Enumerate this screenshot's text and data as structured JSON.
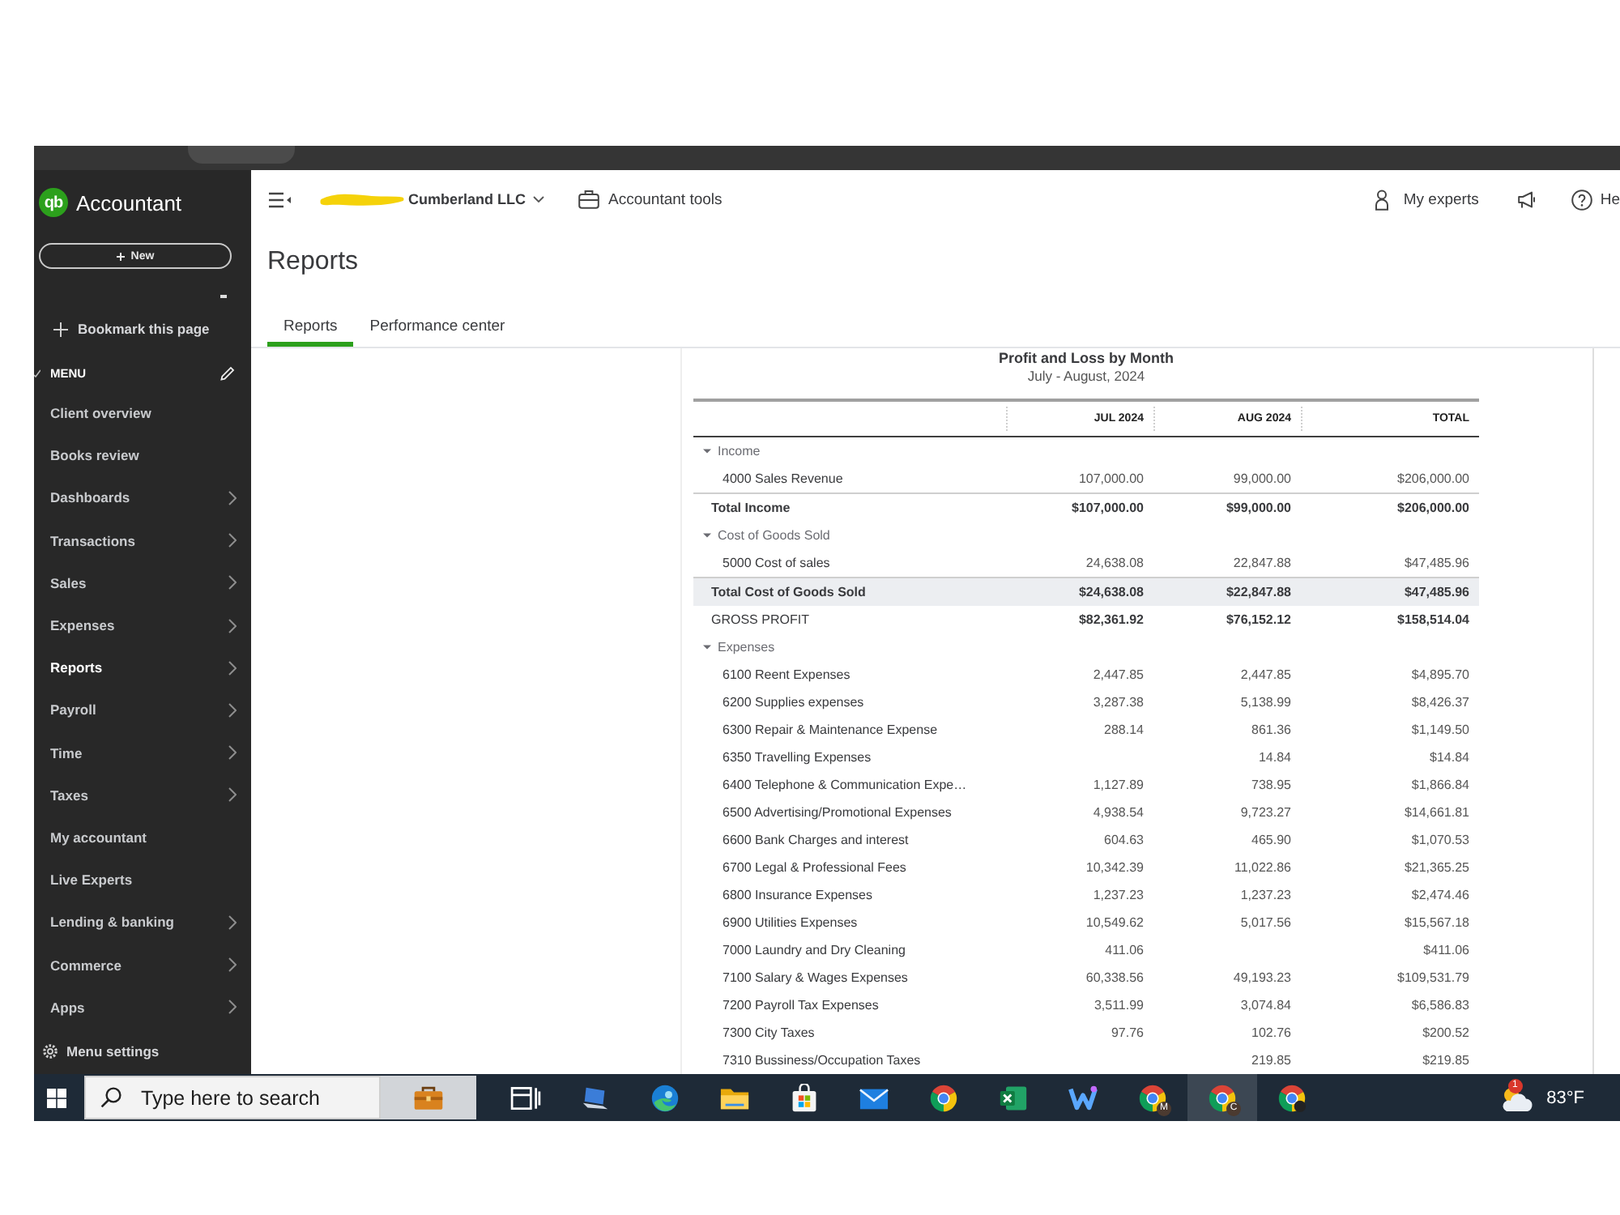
{
  "sidebar": {
    "logo_mark": "qb",
    "product": "Accountant",
    "new_button": "New",
    "bookmark": "Bookmark this page",
    "menu_heading": "MENU",
    "items": [
      {
        "label": "Client overview",
        "submenu": false,
        "selected": false
      },
      {
        "label": "Books review",
        "submenu": false,
        "selected": false
      },
      {
        "label": "Dashboards",
        "submenu": true,
        "selected": false
      },
      {
        "label": "Transactions",
        "submenu": true,
        "selected": false
      },
      {
        "label": "Sales",
        "submenu": true,
        "selected": false
      },
      {
        "label": "Expenses",
        "submenu": true,
        "selected": false
      },
      {
        "label": "Reports",
        "submenu": true,
        "selected": true
      },
      {
        "label": "Payroll",
        "submenu": true,
        "selected": false
      },
      {
        "label": "Time",
        "submenu": true,
        "selected": false
      },
      {
        "label": "Taxes",
        "submenu": true,
        "selected": false
      },
      {
        "label": "My accountant",
        "submenu": false,
        "selected": false
      },
      {
        "label": "Live Experts",
        "submenu": false,
        "selected": false
      },
      {
        "label": "Lending & banking",
        "submenu": true,
        "selected": false
      },
      {
        "label": "Commerce",
        "submenu": true,
        "selected": false
      },
      {
        "label": "Apps",
        "submenu": true,
        "selected": false
      }
    ],
    "settings": "Menu settings"
  },
  "header": {
    "company": "Cumberland LLC",
    "accountant_tools": "Accountant tools",
    "my_experts": "My experts",
    "help": "He"
  },
  "page": {
    "title": "Reports",
    "tabs": [
      {
        "label": "Reports",
        "selected": true
      },
      {
        "label": "Performance center",
        "selected": false
      }
    ]
  },
  "report": {
    "title": "Profit and Loss by Month",
    "subtitle": "July - August, 2024",
    "columns": [
      "JUL 2024",
      "AUG 2024",
      "TOTAL"
    ],
    "rows": [
      {
        "kind": "section",
        "label": "Income",
        "expanded": true,
        "highlighted": false,
        "children": [
          {
            "label": "4000 Sales Revenue",
            "jul_2024": "107,000.00",
            "aug_2024": "99,000.00",
            "total": "$206,000.00"
          }
        ]
      },
      {
        "kind": "total",
        "label": "Total Income",
        "highlighted": false,
        "jul_2024": "$107,000.00",
        "aug_2024": "$99,000.00",
        "total": "$206,000.00"
      },
      {
        "kind": "section",
        "label": "Cost of Goods Sold",
        "expanded": true,
        "highlighted": false,
        "children": [
          {
            "label": "5000 Cost of sales",
            "jul_2024": "24,638.08",
            "aug_2024": "22,847.88",
            "total": "$47,485.96"
          }
        ]
      },
      {
        "kind": "total",
        "label": "Total Cost of Goods Sold",
        "highlighted": true,
        "jul_2024": "$24,638.08",
        "aug_2024": "$22,847.88",
        "total": "$47,485.96"
      },
      {
        "kind": "summary",
        "label": "GROSS PROFIT",
        "highlighted": false,
        "jul_2024": "$82,361.92",
        "aug_2024": "$76,152.12",
        "total": "$158,514.04"
      },
      {
        "kind": "section",
        "label": "Expenses",
        "expanded": true,
        "highlighted": false,
        "children": [
          {
            "label": "6100 Reent Expenses",
            "jul_2024": "2,447.85",
            "aug_2024": "2,447.85",
            "total": "$4,895.70"
          },
          {
            "label": "6200 Supplies expenses",
            "jul_2024": "3,287.38",
            "aug_2024": "5,138.99",
            "total": "$8,426.37"
          },
          {
            "label": "6300 Repair & Maintenance Expense",
            "jul_2024": "288.14",
            "aug_2024": "861.36",
            "total": "$1,149.50"
          },
          {
            "label": "6350 Travelling Expenses",
            "aug_2024": "14.84",
            "total": "$14.84"
          },
          {
            "label": "6400 Telephone & Communication Expe…",
            "jul_2024": "1,127.89",
            "aug_2024": "738.95",
            "total": "$1,866.84"
          },
          {
            "label": "6500 Advertising/Promotional Expenses",
            "jul_2024": "4,938.54",
            "aug_2024": "9,723.27",
            "total": "$14,661.81"
          },
          {
            "label": "6600 Bank Charges and interest",
            "jul_2024": "604.63",
            "aug_2024": "465.90",
            "total": "$1,070.53"
          },
          {
            "label": "6700 Legal & Professional Fees",
            "jul_2024": "10,342.39",
            "aug_2024": "11,022.86",
            "total": "$21,365.25"
          },
          {
            "label": "6800 Insurance Expenses",
            "jul_2024": "1,237.23",
            "aug_2024": "1,237.23",
            "total": "$2,474.46"
          },
          {
            "label": "6900 Utilities Expenses",
            "jul_2024": "10,549.62",
            "aug_2024": "5,017.56",
            "total": "$15,567.18"
          },
          {
            "label": "7000 Laundry and Dry Cleaning",
            "jul_2024": "411.06",
            "total": "$411.06"
          },
          {
            "label": "7100 Salary & Wages Expenses",
            "jul_2024": "60,338.56",
            "aug_2024": "49,193.23",
            "total": "$109,531.79"
          },
          {
            "label": "7200 Payroll Tax Expenses",
            "jul_2024": "3,511.99",
            "aug_2024": "3,074.84",
            "total": "$6,586.83"
          },
          {
            "label": "7300 City Taxes",
            "jul_2024": "97.76",
            "aug_2024": "102.76",
            "total": "$200.52"
          },
          {
            "label": "7310 Bussiness/Occupation Taxes",
            "aug_2024": "219.85",
            "total": "$219.85"
          }
        ]
      }
    ]
  },
  "taskbar": {
    "search": {
      "placeholder": "Type here to search"
    },
    "apps": [
      {
        "kind": "briefcase",
        "active": false
      },
      {
        "kind": "task-view",
        "active": false
      },
      {
        "kind": "laptop",
        "active": false
      },
      {
        "kind": "edge",
        "active": false
      },
      {
        "kind": "folder",
        "active": false
      },
      {
        "kind": "store",
        "active": false
      },
      {
        "kind": "mail",
        "active": false
      },
      {
        "kind": "chrome",
        "active": false
      },
      {
        "kind": "excel",
        "active": false
      },
      {
        "kind": "zigzag",
        "active": false
      },
      {
        "kind": "chrome-profile",
        "badge": "M",
        "active": false
      },
      {
        "kind": "chrome-profile",
        "badge": "C",
        "active": true
      },
      {
        "kind": "chrome-profile-dark",
        "active": false
      }
    ],
    "weather": {
      "badge": "1",
      "temperature": "83°F"
    }
  }
}
